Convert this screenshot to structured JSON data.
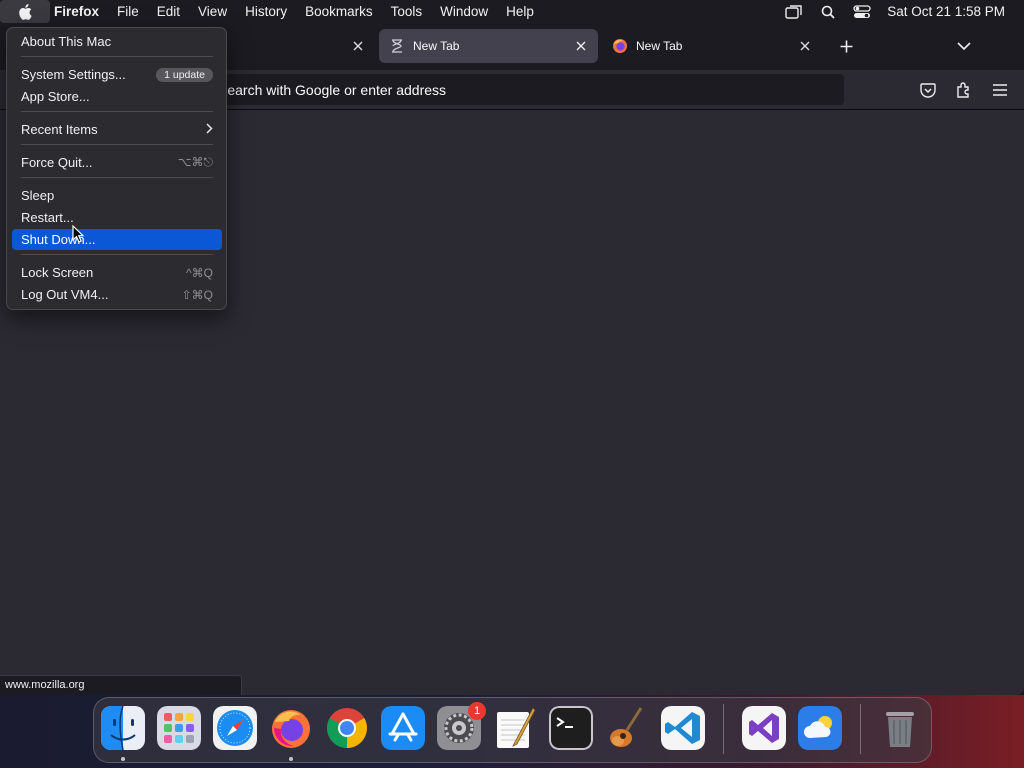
{
  "menubar": {
    "app_name": "Firefox",
    "items": [
      "File",
      "Edit",
      "View",
      "History",
      "Bookmarks",
      "Tools",
      "Window",
      "Help"
    ],
    "clock": "Sat Oct 21  1:58 PM",
    "icons": [
      "apple-icon",
      "screen-mirroring-icon",
      "spotlight-search-icon",
      "control-center-icon"
    ]
  },
  "browser": {
    "tabs": [
      {
        "label": "",
        "icon": "none"
      },
      {
        "label": "New Tab",
        "icon": "loading-hourglass-icon",
        "selected": true
      },
      {
        "label": "New Tab",
        "icon": "firefox-icon"
      }
    ],
    "url_placeholder": "Search with Google or enter address",
    "status_link": "www.mozilla.org",
    "colors": {
      "tabstrip": "#1c1b22",
      "toolbar": "#2b2a33",
      "selected_tab": "#42414d"
    }
  },
  "apple_menu": {
    "about": "About This Mac",
    "system_settings": "System Settings...",
    "update_badge": "1 update",
    "app_store": "App Store...",
    "recent_items": "Recent Items",
    "force_quit": "Force Quit...",
    "force_quit_shortcut": "⌥⌘⎋",
    "sleep": "Sleep",
    "restart": "Restart...",
    "shut_down": "Shut Down...",
    "lock_screen": "Lock Screen",
    "lock_shortcut": "^⌘Q",
    "log_out": "Log Out VM4...",
    "log_out_shortcut": "⇧⌘Q",
    "highlight_color": "#0a58d6"
  },
  "dock": {
    "apps": [
      "Finder",
      "Launchpad",
      "Safari",
      "Firefox",
      "Google Chrome",
      "App Store",
      "System Settings",
      "TextEdit",
      "Terminal",
      "GarageBand",
      "Visual Studio Code",
      "Visual Studio",
      "Weather",
      "Trash"
    ],
    "settings_badge": "1"
  }
}
